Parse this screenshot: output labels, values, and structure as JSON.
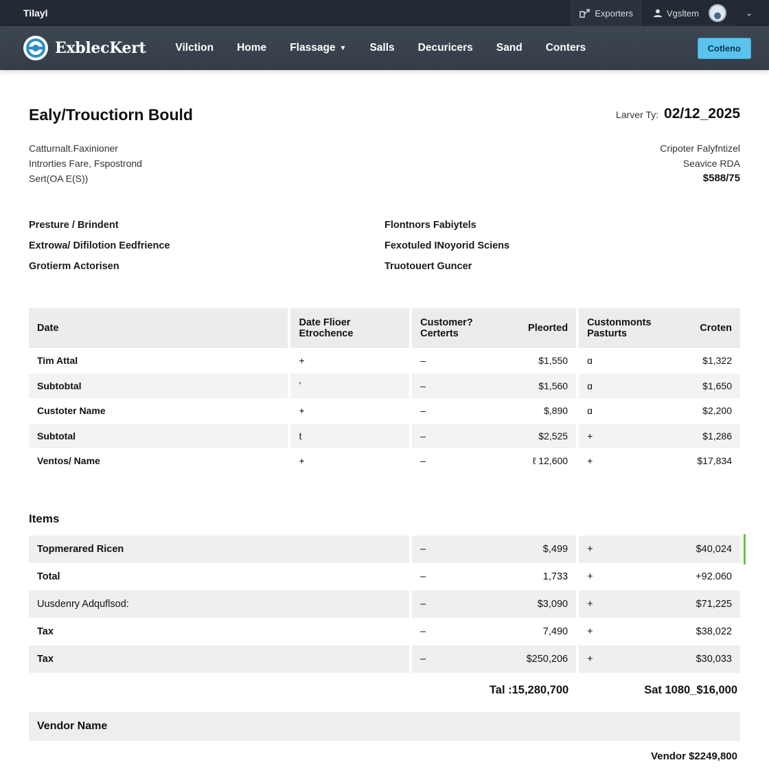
{
  "topbar": {
    "brand": "Tilayl",
    "exporters_label": "Exporters",
    "user_label": "Vgsltem"
  },
  "navbar": {
    "logo_text": "ExblecKert",
    "items": [
      {
        "label": "Vilction"
      },
      {
        "label": "Home"
      },
      {
        "label": "Flassage"
      },
      {
        "label": "Salls"
      },
      {
        "label": "Decuricers"
      },
      {
        "label": "Sand"
      },
      {
        "label": "Conters"
      }
    ],
    "cta_label": "Cotleno"
  },
  "doc": {
    "title": "Ealy/Trouctiorn Bould",
    "date_label": "Larver Ty:",
    "date_value": "02/12_2025",
    "left_address": [
      "Catturnalt.Faxinioner",
      "Introrties Fare, Fspostrond",
      "Sert(OA E(S))"
    ],
    "right_address": [
      "Cripoter Falyfntizel",
      "Seavice RDA"
    ],
    "right_amount": "$588/75"
  },
  "fields": {
    "left": [
      "Presture / Brindent",
      "Extrowa/ Difilotion Eedfrience",
      "Grotierm Actorisen"
    ],
    "right": [
      "Flontnors Fabiytels",
      "Fexotuled INoyorid Sciens",
      "Truotouert Guncer"
    ]
  },
  "table1": {
    "headers": {
      "date": "Date",
      "date_filter_1": "Date Flioer",
      "date_filter_2": "Etrochence",
      "customer_1": "Customer?",
      "customer_2": "Certerts",
      "posted": "Pleorted",
      "custonmonts_1": "Custonmonts",
      "custonmonts_2": "Pasturts",
      "croten": "Croten"
    },
    "rows": [
      {
        "label": "Tim Attal",
        "a": "+",
        "b": "–",
        "c": "$1,550",
        "d": "ɑ",
        "e": "$1,322"
      },
      {
        "label": "Subtobtal",
        "a": "ʼ",
        "b": "–",
        "c": "$1,560",
        "d": "ɑ",
        "e": "$1,650"
      },
      {
        "label": "Custoter Name",
        "a": "+",
        "b": "–",
        "c": "$,890",
        "d": "ɑ",
        "e": "$2,200"
      },
      {
        "label": "Subtotal",
        "a": "t",
        "b": "–",
        "c": "$2,525",
        "d": "+",
        "e": "$1,286"
      },
      {
        "label": "Ventos/ Name",
        "a": "+",
        "b": "–",
        "c": "ℓ 12,600",
        "d": "+",
        "e": "$17,834"
      }
    ]
  },
  "items": {
    "title": "Items",
    "rows": [
      {
        "label": "Topmerared Ricen",
        "b": "–",
        "c": "$,499",
        "d": "+",
        "e": "$40,024"
      },
      {
        "label": "Total",
        "b": "–",
        "c": "1,733",
        "d": "+",
        "e": "+92.060"
      },
      {
        "label": "Uusdenry Adquflsod:",
        "b": "–",
        "c": "$3,090",
        "d": "+",
        "e": "$71,225"
      },
      {
        "label": "Tax",
        "b": "–",
        "c": "7,490",
        "d": "+",
        "e": "$38,022"
      },
      {
        "label": "Tax",
        "b": "–",
        "c": "$250,206",
        "d": "+",
        "e": "$30,033"
      }
    ]
  },
  "totals": {
    "left": "Tal :15,280,700",
    "right": "Sat 1080_$16,000"
  },
  "vendor": {
    "bar_label": "Vendor Name",
    "total": "Vendor $2249,800"
  },
  "colors": {
    "topbar": "#232a33",
    "navbar": "#3a434e",
    "cta": "#5bc4ee",
    "accent_green": "#6cc24a"
  }
}
